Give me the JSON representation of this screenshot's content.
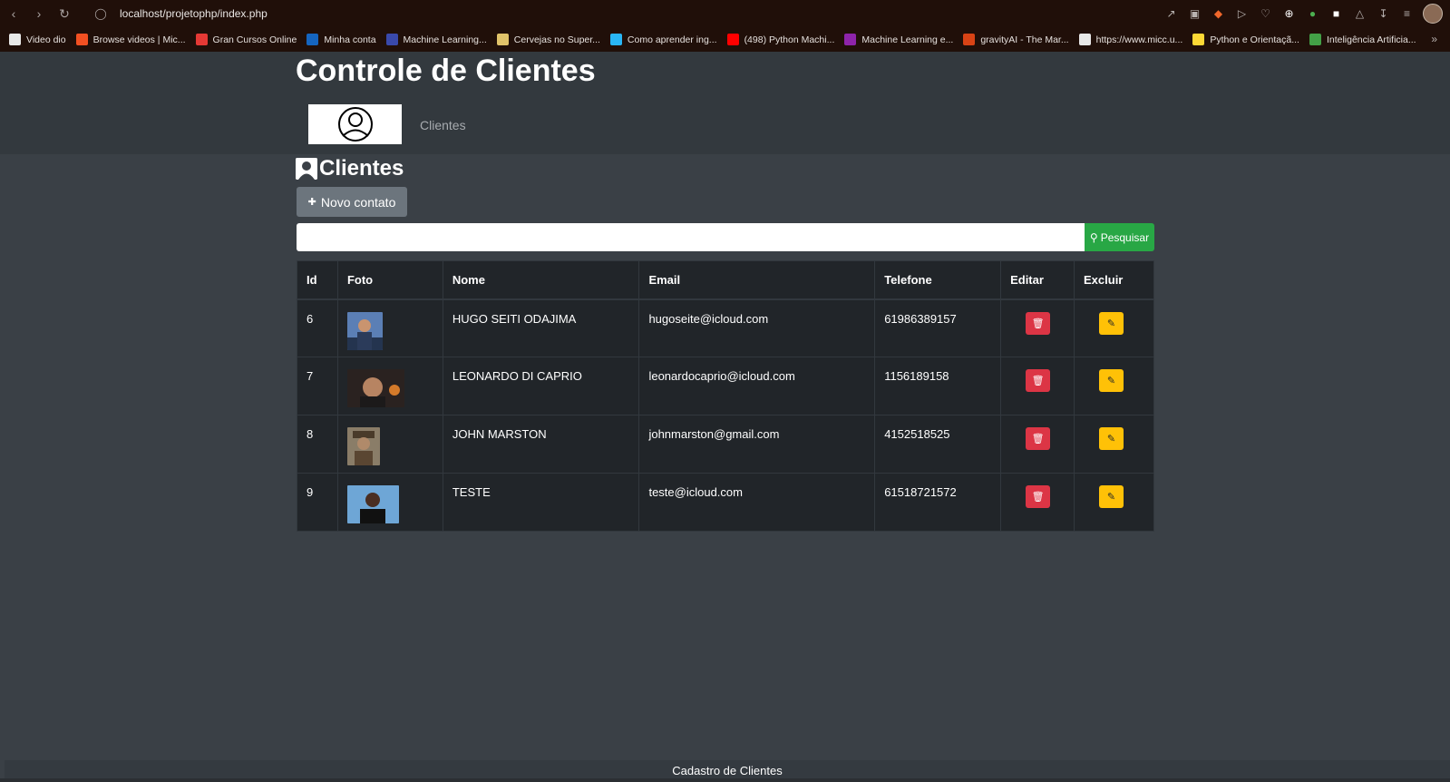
{
  "browser": {
    "url": "localhost/projetophp/index.php",
    "bookmarks": [
      {
        "label": "Video dio",
        "color": "#e8e8e8"
      },
      {
        "label": "Browse videos | Mic...",
        "color": "#f25022"
      },
      {
        "label": "Gran Cursos Online",
        "color": "#e53935"
      },
      {
        "label": "Minha conta",
        "color": "#1565c0"
      },
      {
        "label": "Machine Learning...",
        "color": "#3949ab"
      },
      {
        "label": "Cervejas no Super...",
        "color": "#e0c36a"
      },
      {
        "label": "Como aprender ing...",
        "color": "#29b6f6"
      },
      {
        "label": "(498) Python Machi...",
        "color": "#ff0000"
      },
      {
        "label": "Machine Learning e...",
        "color": "#8e24aa"
      },
      {
        "label": "gravityAI - The Mar...",
        "color": "#d84315"
      },
      {
        "label": "https://www.micc.u...",
        "color": "#e8e8e8"
      },
      {
        "label": "Python e Orientaçã...",
        "color": "#fdd835"
      },
      {
        "label": "Inteligência Artificia...",
        "color": "#43a047"
      }
    ]
  },
  "header": {
    "title": "Controle de Clientes",
    "nav_link": "Clientes"
  },
  "main": {
    "section_title": "Clientes",
    "new_button": "Novo contato",
    "search_button": "Pesquisar",
    "search_value": ""
  },
  "table": {
    "columns": [
      "Id",
      "Foto",
      "Nome",
      "Email",
      "Telefone",
      "Editar",
      "Excluir"
    ],
    "rows": [
      {
        "id": "6",
        "nome": "HUGO SEITI ODAJIMA",
        "email": "hugoseite@icloud.com",
        "telefone": "61986389157"
      },
      {
        "id": "7",
        "nome": "LEONARDO DI CAPRIO",
        "email": "leonardocaprio@icloud.com",
        "telefone": "1156189158"
      },
      {
        "id": "8",
        "nome": "JOHN MARSTON",
        "email": "johnmarston@gmail.com",
        "telefone": "4152518525"
      },
      {
        "id": "9",
        "nome": "TESTE",
        "email": "teste@icloud.com",
        "telefone": "61518721572"
      }
    ]
  },
  "footer": {
    "text": "Cadastro de Clientes"
  },
  "colors": {
    "page_bg": "#3a4046",
    "header_bg": "#33393e",
    "table_bg": "#212529",
    "success": "#28a745",
    "danger": "#dc3545",
    "warning": "#ffc107",
    "secondary": "#6c757d"
  }
}
